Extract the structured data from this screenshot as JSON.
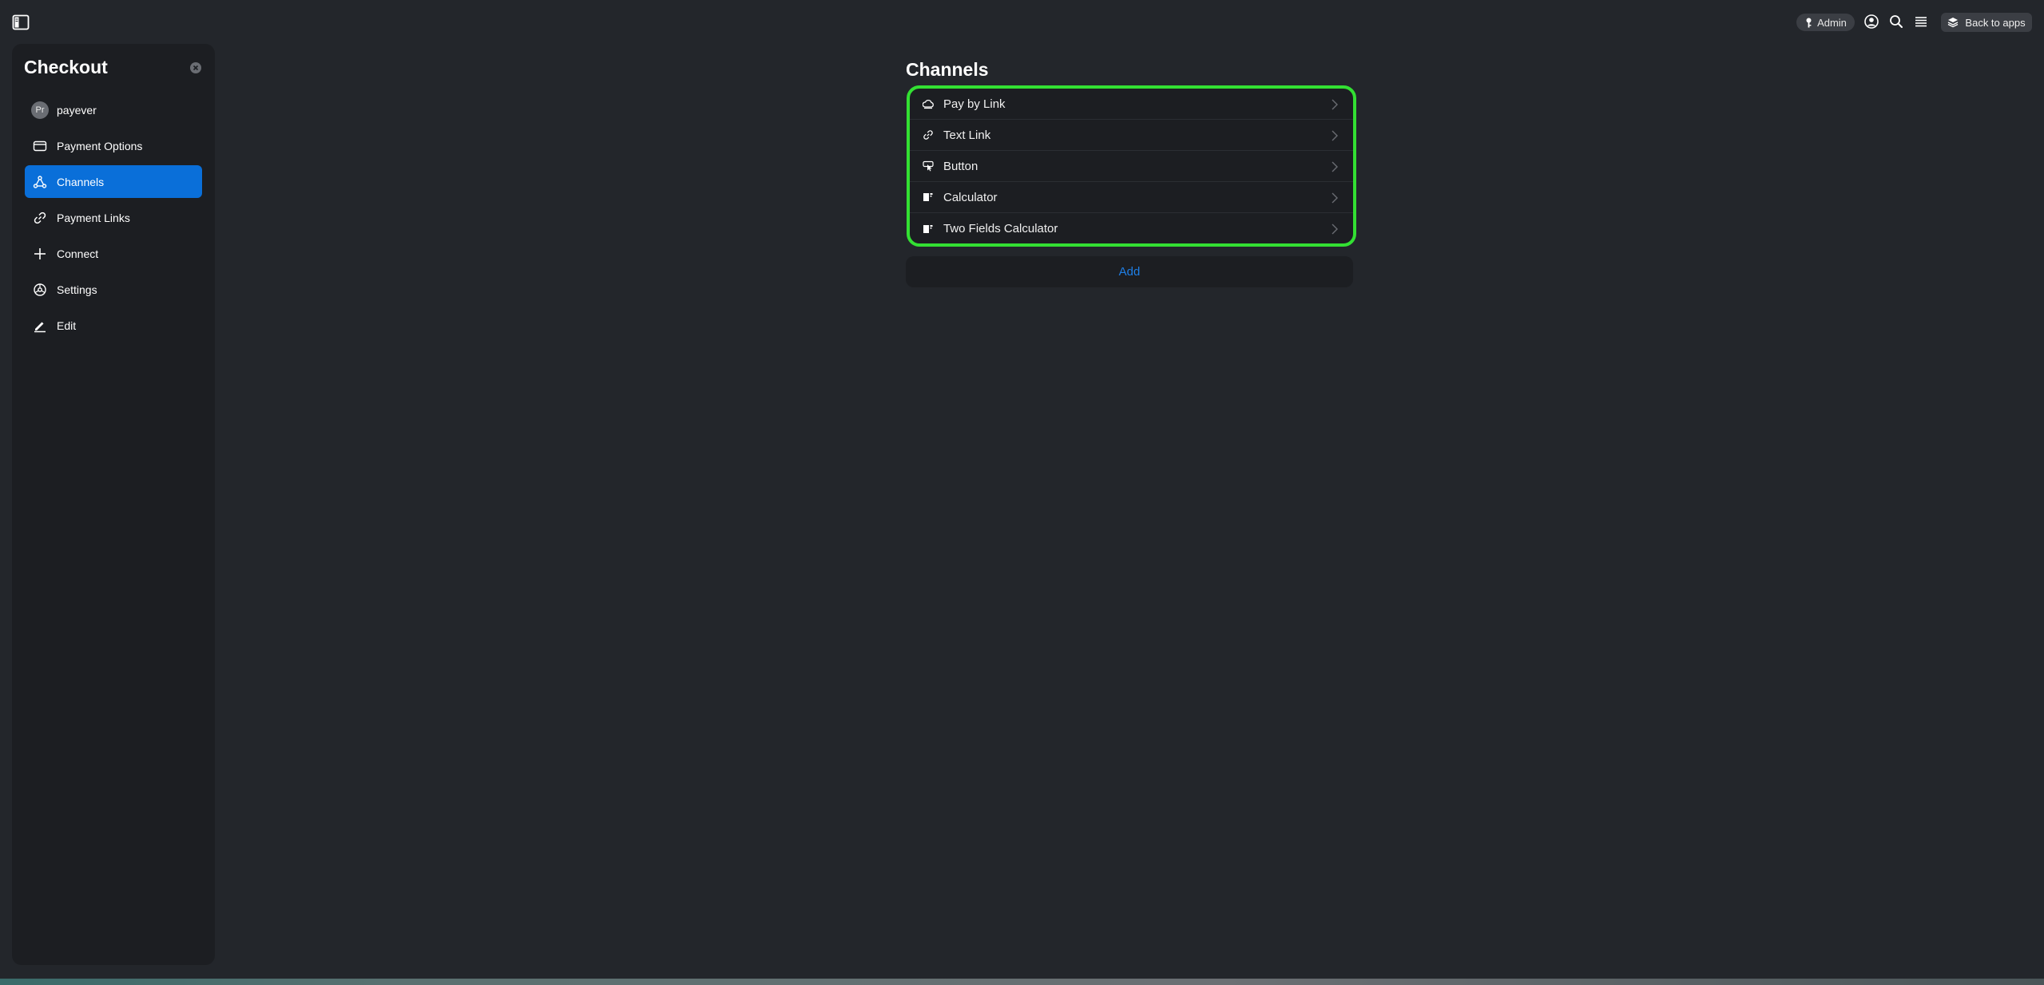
{
  "topbar": {
    "admin_label": "Admin",
    "back_label": "Back to apps"
  },
  "sidebar": {
    "title": "Checkout",
    "items": [
      {
        "label": "payever",
        "avatar": "Pr",
        "icon": "avatar",
        "active": false
      },
      {
        "label": "Payment Options",
        "icon": "card-icon",
        "active": false
      },
      {
        "label": "Channels",
        "icon": "channels-icon",
        "active": true
      },
      {
        "label": "Payment Links",
        "icon": "link-icon",
        "active": false
      },
      {
        "label": "Connect",
        "icon": "plus-icon",
        "active": false
      },
      {
        "label": "Settings",
        "icon": "settings-icon",
        "active": false
      },
      {
        "label": "Edit",
        "icon": "pencil-icon",
        "active": false
      }
    ]
  },
  "main": {
    "title": "Channels",
    "channels": [
      {
        "label": "Pay by Link",
        "icon": "cloud-icon"
      },
      {
        "label": "Text Link",
        "icon": "link-icon"
      },
      {
        "label": "Button",
        "icon": "button-icon"
      },
      {
        "label": "Calculator",
        "icon": "calculator-icon"
      },
      {
        "label": "Two Fields Calculator",
        "icon": "calculator-icon"
      }
    ],
    "add_label": "Add"
  },
  "colors": {
    "background": "#23262b",
    "panel": "#1c1e22",
    "accent": "#0a6fd9",
    "highlight": "#33e033",
    "link": "#1f7fe6"
  }
}
